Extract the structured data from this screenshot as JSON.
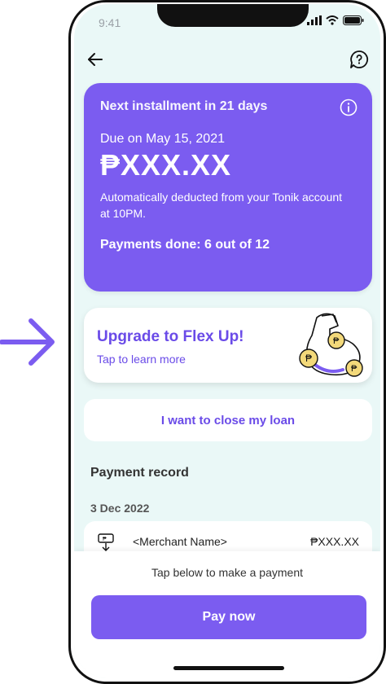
{
  "status_bar": {
    "time": "9:41"
  },
  "header": {
    "back_icon": "arrow-left-icon",
    "help_icon": "help-chat-icon"
  },
  "installment_card": {
    "title": "Next installment in 21 days",
    "due_text": "Due on May 15, 2021",
    "amount": "₱XXX.XX",
    "auto_deduct_text": "Automatically deducted from your Tonik account at 10PM.",
    "payments_done_text": "Payments done: 6 out of 12",
    "background_color": "#7b5cf0"
  },
  "promo": {
    "title": "Upgrade to Flex Up!",
    "subtitle": "Tap to learn more",
    "accent_color": "#6a4be8"
  },
  "close_loan_button": "I want to close my loan",
  "payment_record": {
    "title": "Payment record",
    "groups": [
      {
        "date": "3 Dec 2022",
        "items": [
          {
            "merchant": "<Merchant Name>",
            "amount": "₱XXX.XX"
          }
        ]
      }
    ]
  },
  "footer": {
    "prompt": "Tap below to make a payment",
    "pay_button": "Pay now"
  }
}
